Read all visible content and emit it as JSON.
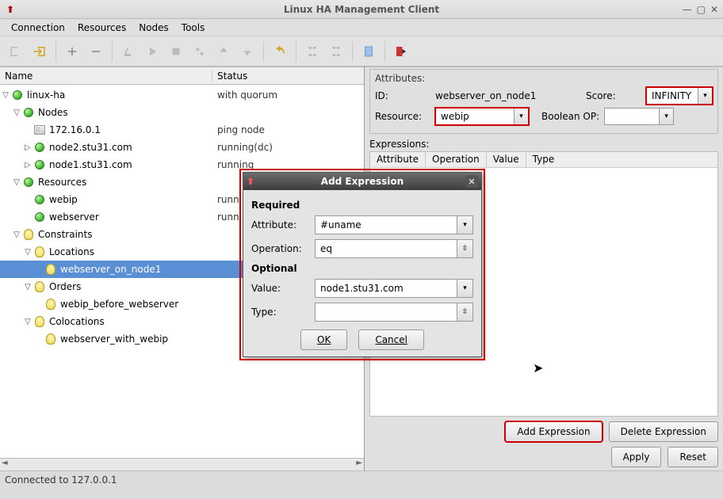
{
  "window": {
    "title": "Linux HA Management Client"
  },
  "menu": {
    "connection": "Connection",
    "resources": "Resources",
    "nodes": "Nodes",
    "tools": "Tools"
  },
  "tree": {
    "header": {
      "name": "Name",
      "status": "Status"
    },
    "root": {
      "label": "linux-ha",
      "status": "with quorum"
    },
    "nodes_label": "Nodes",
    "nodes": [
      {
        "label": "172.16.0.1",
        "status": "ping node",
        "icon": "pg"
      },
      {
        "label": "node2.stu31.com",
        "status": "running(dc)",
        "icon": "green"
      },
      {
        "label": "node1.stu31.com",
        "status": "running",
        "icon": "green"
      }
    ],
    "resources_label": "Resources",
    "resources": [
      {
        "label": "webip",
        "status": "runn"
      },
      {
        "label": "webserver",
        "status": "runn"
      }
    ],
    "constraints_label": "Constraints",
    "locations_label": "Locations",
    "locations": [
      {
        "label": "webserver_on_node1",
        "selected": true
      }
    ],
    "orders_label": "Orders",
    "orders": [
      {
        "label": "webip_before_webserver"
      }
    ],
    "colocations_label": "Colocations",
    "colocations": [
      {
        "label": "webserver_with_webip"
      }
    ]
  },
  "attrs": {
    "header": "Attributes:",
    "id_label": "ID:",
    "id_value": "webserver_on_node1",
    "score_label": "Score:",
    "score_value": "INFINITY",
    "resource_label": "Resource:",
    "resource_value": "webip",
    "boolop_label": "Boolean OP:",
    "boolop_value": ""
  },
  "expr": {
    "header": "Expressions:",
    "cols": {
      "attribute": "Attribute",
      "operation": "Operation",
      "value": "Value",
      "type": "Type"
    },
    "add_btn": "Add Expression",
    "del_btn": "Delete Expression",
    "apply": "Apply",
    "reset": "Reset"
  },
  "dialog": {
    "title": "Add Expression",
    "required": "Required",
    "optional": "Optional",
    "attribute_label": "Attribute:",
    "attribute_value": "#uname",
    "operation_label": "Operation:",
    "operation_value": "eq",
    "value_label": "Value:",
    "value_value": "node1.stu31.com",
    "type_label": "Type:",
    "type_value": "",
    "ok": "OK",
    "cancel": "Cancel"
  },
  "status_bar": "Connected to 127.0.0.1"
}
